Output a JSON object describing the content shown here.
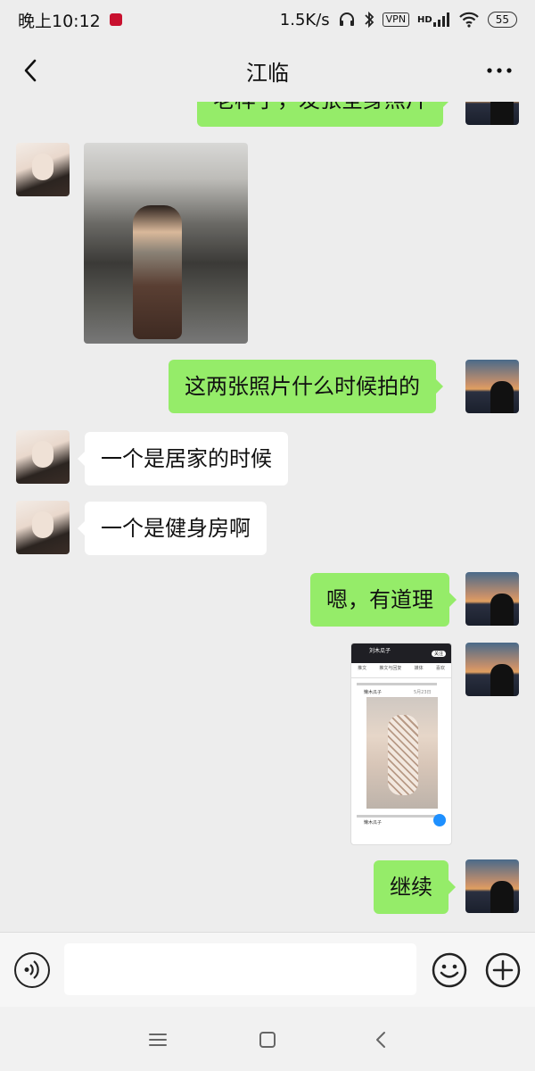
{
  "status_bar": {
    "time": "晚上10:12",
    "net_speed": "1.5K/s",
    "vpn": "VPN",
    "signal_label": "HD",
    "battery": "55",
    "icons": [
      "headphones-icon",
      "bluetooth-icon",
      "vpn-icon",
      "signal-icon",
      "wifi-icon",
      "battery-icon"
    ]
  },
  "header": {
    "title": "江临",
    "back_icon": "chevron-left-icon",
    "more_icon": "more-dots-icon"
  },
  "messages": [
    {
      "side": "right",
      "type": "text",
      "text": "老样子，发张全身照片",
      "partial": true
    },
    {
      "side": "left",
      "type": "image",
      "description_icon": "gym-photo"
    },
    {
      "side": "right",
      "type": "text",
      "text": "这两张照片什么时候拍的"
    },
    {
      "side": "left",
      "type": "text",
      "text": "一个是居家的时候"
    },
    {
      "side": "left",
      "type": "text",
      "text": "一个是健身房啊"
    },
    {
      "side": "right",
      "type": "text",
      "text": "嗯，有道理"
    },
    {
      "side": "right",
      "type": "image",
      "description_icon": "screenshot-photo"
    },
    {
      "side": "right",
      "type": "text",
      "text": "继续"
    }
  ],
  "screenshot_text": {
    "profile": "刘木瓜子",
    "follow": "关注",
    "tabs": [
      "推文",
      "推文与回复",
      "媒体",
      "喜欢"
    ],
    "post_user": "懒木瓜子",
    "post_date": "5月23日",
    "reply_user": "懒木瓜子"
  },
  "input_bar": {
    "value": "",
    "placeholder": "",
    "voice_icon": "voice-icon",
    "emoji_icon": "emoji-icon",
    "plus_icon": "plus-icon"
  },
  "system_nav": {
    "icons": [
      "menu-icon",
      "home-square-icon",
      "back-triangle-icon"
    ]
  },
  "colors": {
    "background": "#ededed",
    "bubble_sent": "#95ec69",
    "bubble_received": "#ffffff"
  }
}
